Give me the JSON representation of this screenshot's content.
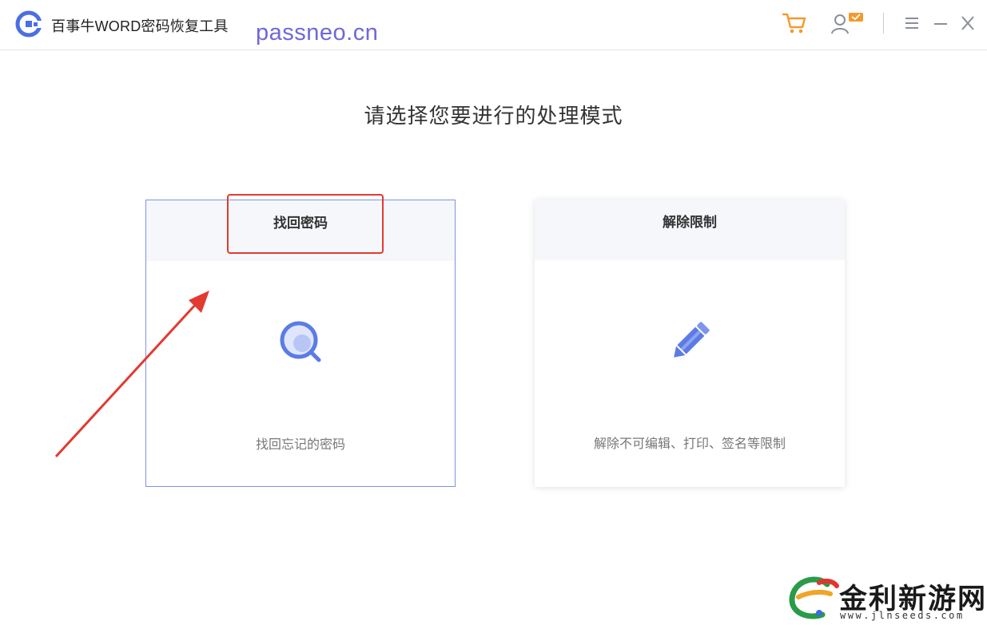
{
  "app": {
    "title": "百事牛WORD密码恢复工具",
    "icons": {
      "logo": "app-logo-icon",
      "cart": "cart-icon",
      "user": "user-account-icon",
      "menu": "menu-icon",
      "minimize": "minimize-icon",
      "close": "close-icon"
    }
  },
  "watermark": {
    "site": "passneo.cn",
    "brand_name": "金利新游网",
    "brand_url": "www.jlnseeds.com"
  },
  "main": {
    "heading": "请选择您要进行的处理模式",
    "cards": [
      {
        "title": "找回密码",
        "description": "找回忘记的密码",
        "icon": "search-magnifier-icon"
      },
      {
        "title": "解除限制",
        "description": "解除不可编辑、打印、签名等限制",
        "icon": "pencil-edit-icon"
      }
    ]
  },
  "colors": {
    "accent": "#5b7be6",
    "icon_orange": "#f39a2b",
    "annotation_red": "#e23a30",
    "watermark_purple": "#6f67d9"
  }
}
